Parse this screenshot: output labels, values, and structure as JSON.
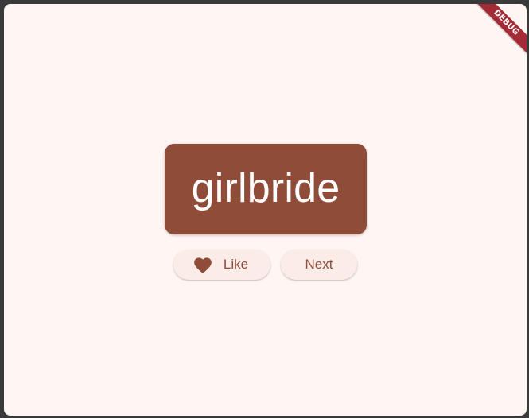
{
  "app": {
    "background_color": "#fff6f4",
    "accent_color": "#8f4c39"
  },
  "word_card": {
    "text": "girlbride"
  },
  "actions": {
    "like_label": "Like",
    "like_icon": "heart-icon",
    "next_label": "Next"
  },
  "debug_banner": {
    "label": "DEBUG",
    "color": "#a42a35"
  }
}
